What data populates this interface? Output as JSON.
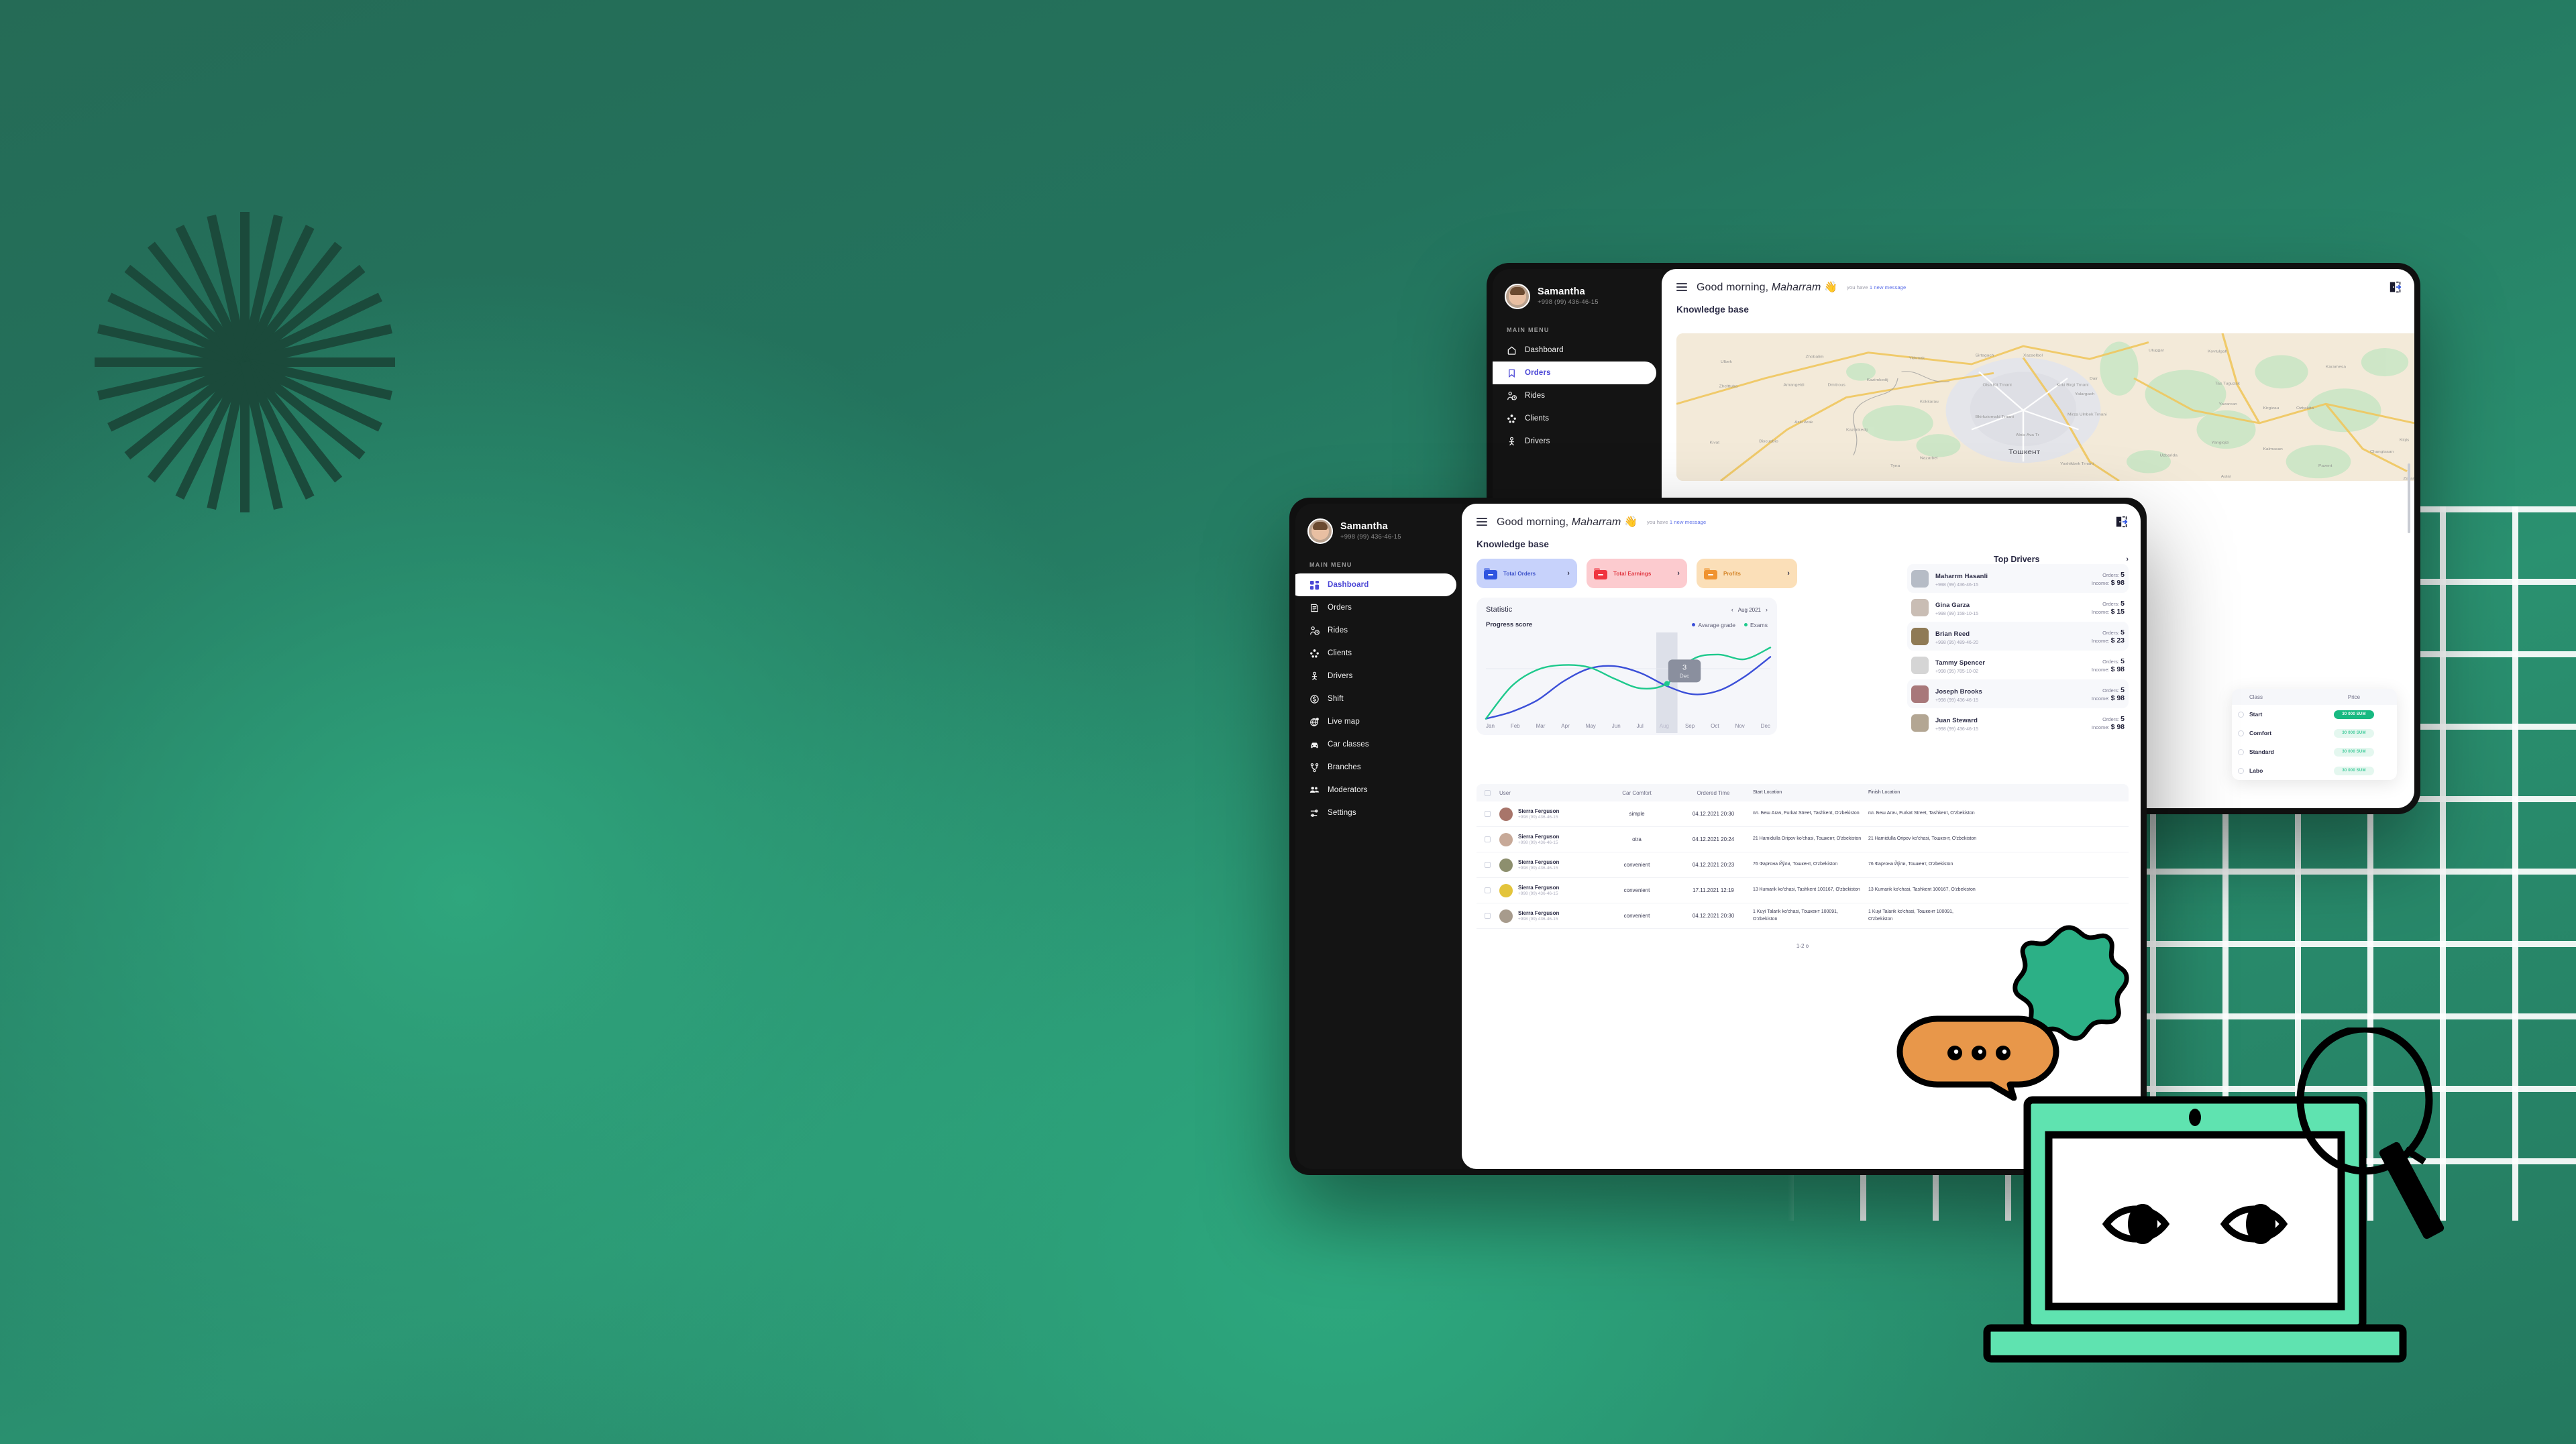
{
  "app": {
    "user": {
      "name": "Samantha",
      "phone": "+998 (99) 436-46-15"
    },
    "menu_section_label": "MAIN MENU",
    "menu_items_front": [
      {
        "label": "Dashboard",
        "icon": "grid-icon",
        "active": true
      },
      {
        "label": "Orders",
        "icon": "orders-icon",
        "active": false
      },
      {
        "label": "Rides",
        "icon": "rides-icon",
        "active": false
      },
      {
        "label": "Clients",
        "icon": "clients-icon",
        "active": false
      },
      {
        "label": "Drivers",
        "icon": "drivers-icon",
        "active": false
      },
      {
        "label": "Shift",
        "icon": "shift-icon",
        "active": false
      },
      {
        "label": "Live map",
        "icon": "live-map-icon",
        "active": false
      },
      {
        "label": "Car classes",
        "icon": "car-icon",
        "active": false
      },
      {
        "label": "Branches",
        "icon": "branches-icon",
        "active": false
      },
      {
        "label": "Moderators",
        "icon": "moderators-icon",
        "active": false
      },
      {
        "label": "Settings",
        "icon": "settings-icon",
        "active": false
      }
    ],
    "menu_items_back": [
      {
        "label": "Dashboard",
        "icon": "home-icon",
        "active": false
      },
      {
        "label": "Orders",
        "icon": "bookmark-icon",
        "active": true
      },
      {
        "label": "Rides",
        "icon": "rides-icon",
        "active": false
      },
      {
        "label": "Clients",
        "icon": "clients-icon",
        "active": false
      },
      {
        "label": "Drivers",
        "icon": "drivers-icon",
        "active": false
      }
    ]
  },
  "header": {
    "greeting": "Good morning, ",
    "greeting_name": "Maharram",
    "wave": "👋",
    "message_prefix": "you have ",
    "message_link": "1 new message",
    "logout_icon": "logout-icon",
    "menu_icon": "hamburger-icon"
  },
  "main": {
    "section_title": "Knowledge base",
    "drivers_title": "Top Drivers",
    "drivers_chevron": "›"
  },
  "cards": [
    {
      "label": "Total Orders",
      "color": "#3b50c9",
      "bg": "#c7d2fb",
      "icon_color": "#2f54e0",
      "chevron": "›"
    },
    {
      "label": "Total Earnings",
      "color": "#e0353f",
      "bg": "#fccbcf",
      "icon_color": "#f0343f",
      "chevron": "›"
    },
    {
      "label": "Profits",
      "color": "#d48427",
      "bg": "#fbdfb8",
      "icon_color": "#f09330",
      "chevron": "›"
    }
  ],
  "statistic": {
    "title": "Statistic",
    "period": "Aug 2021",
    "prev": "‹",
    "next": "›",
    "subtitle": "Progress score",
    "tooltip_value": "3",
    "tooltip_label": "Dec"
  },
  "chart_data": {
    "type": "line",
    "title": "Progress score",
    "xlabel": "",
    "ylabel": "",
    "categories": [
      "Jan",
      "Feb",
      "Mar",
      "Apr",
      "May",
      "Jun",
      "Jul",
      "Aug",
      "Sep",
      "Oct",
      "Nov",
      "Dec"
    ],
    "highlight_category": "Aug",
    "grid": false,
    "legend_position": "top-right",
    "ylim": [
      0,
      10
    ],
    "series": [
      {
        "name": "Avarage grade",
        "color": "#3b4fd8",
        "values": [
          1.0,
          1.6,
          2.6,
          4.2,
          5.3,
          5.5,
          4.9,
          3.8,
          3.1,
          3.4,
          4.6,
          6.3
        ]
      },
      {
        "name": "Exams",
        "color": "#1ec98c",
        "values": [
          1.0,
          3.8,
          5.2,
          5.6,
          5.4,
          4.4,
          3.6,
          4.0,
          6.1,
          6.5,
          6.1,
          7.1
        ]
      }
    ]
  },
  "top_drivers": [
    {
      "name": "Maharrm Hasanli",
      "phone": "+998 (99) 436-46-15",
      "orders_label": "Orders:",
      "orders": "5",
      "income_label": "Income:",
      "income": "$ 98",
      "avatar_color": "#b6bcc6"
    },
    {
      "name": "Gina Garza",
      "phone": "+998 (99) 158-10-15",
      "orders_label": "Orders:",
      "orders": "5",
      "income_label": "Income:",
      "income": "$ 15",
      "avatar_color": "#c9bdb4"
    },
    {
      "name": "Brian Reed",
      "phone": "+998 (95) 489-46-20",
      "orders_label": "Orders:",
      "orders": "5",
      "income_label": "Income:",
      "income": "$ 23",
      "avatar_color": "#8f7a55"
    },
    {
      "name": "Tammy Spencer",
      "phone": "+998 (95) 785-10-02",
      "orders_label": "Orders:",
      "orders": "5",
      "income_label": "Income:",
      "income": "$ 98",
      "avatar_color": "#d5d5d5"
    },
    {
      "name": "Joseph Brooks",
      "phone": "+998 (99) 436-46-15",
      "orders_label": "Orders:",
      "orders": "5",
      "income_label": "Income:",
      "income": "$ 98",
      "avatar_color": "#a8787a"
    },
    {
      "name": "Juan Steward",
      "phone": "+998 (99) 436-46-15",
      "orders_label": "Orders:",
      "orders": "5",
      "income_label": "Income:",
      "income": "$ 98",
      "avatar_color": "#b3a693"
    }
  ],
  "table": {
    "columns": [
      "User",
      "Car Comfort",
      "Ordered Time",
      "Start Location",
      "Finish Location"
    ],
    "rows": [
      {
        "name": "Sierra Ferguson",
        "phone": "+998 (99) 436-46-15",
        "comfort": "simple",
        "time": "04.12.2021 20:30",
        "start": "пл. Беш Агач, Furkat Street, Tashkent, O'zbekiston",
        "finish": "пл. Беш Агач, Furkat Street, Tashkent, O'zbekiston",
        "avatar_color": "#a8756a"
      },
      {
        "name": "Sierra Ferguson",
        "phone": "+998 (99) 436-46-15",
        "comfort": "otra",
        "time": "04.12.2021 20:24",
        "start": "21 Hamidulla Oripov ko'chasi, Тошкент, O'zbekiston",
        "finish": "21 Hamidulla Oripov ko'chasi, Тошкент, O'zbekiston",
        "avatar_color": "#c7a998"
      },
      {
        "name": "Sierra Ferguson",
        "phone": "+998 (99) 436-46-15",
        "comfort": "convenient",
        "time": "04.12.2021 20:23",
        "start": "76 Фарғона Йўли, Тошкент, O'zbekiston",
        "finish": "76 Фарғона Йўли, Тошкент, O'zbekiston",
        "avatar_color": "#8d8f6e"
      },
      {
        "name": "Sierra Ferguson",
        "phone": "+998 (99) 436-46-15",
        "comfort": "convenient",
        "time": "17.11.2021 12:19",
        "start": "13 Kumarik ko'chasi, Tashkent 100167, O'zbekiston",
        "finish": "13 Kumarik ko'chasi, Tashkent 100167, O'zbekiston",
        "avatar_color": "#e3c43b"
      },
      {
        "name": "Sierra Ferguson",
        "phone": "+998 (99) 436-46-15",
        "comfort": "convenient",
        "time": "04.12.2021 20:30",
        "start": "1 Kuyi Talarik ko'chasi, Тошкент 100091, O'zbekiston",
        "finish": "1 Kuyi Talarik ko'chasi, Тошкент 100091, O'zbekiston",
        "avatar_color": "#a79b8c"
      }
    ],
    "pagination": "1-2 o"
  },
  "class_table": {
    "columns": [
      "Class",
      "Price"
    ],
    "rows": [
      {
        "class": "Start",
        "price": "30 000 SUM",
        "selected": true
      },
      {
        "class": "Comfort",
        "price": "30 000 SUM",
        "selected": false
      },
      {
        "class": "Standard",
        "price": "30 000 SUM",
        "selected": false
      },
      {
        "class": "Labo",
        "price": "30 000 SUM",
        "selected": false
      }
    ]
  },
  "map": {
    "city_label": "Тошкент"
  },
  "decor": {
    "starburst_rays": 28,
    "blob": "green-blob",
    "bubble_dots": 3,
    "laptop": "laptop-with-eyes",
    "magnifier": "magnifier-icon"
  },
  "colors": {
    "bg_dark": "#256b56",
    "bg_light": "#2fa67d",
    "sidebar": "#141414",
    "accent_blue": "#4b47d6",
    "accent_green": "#18b981",
    "orange": "#e8974a",
    "teal": "#5fe3b0"
  }
}
